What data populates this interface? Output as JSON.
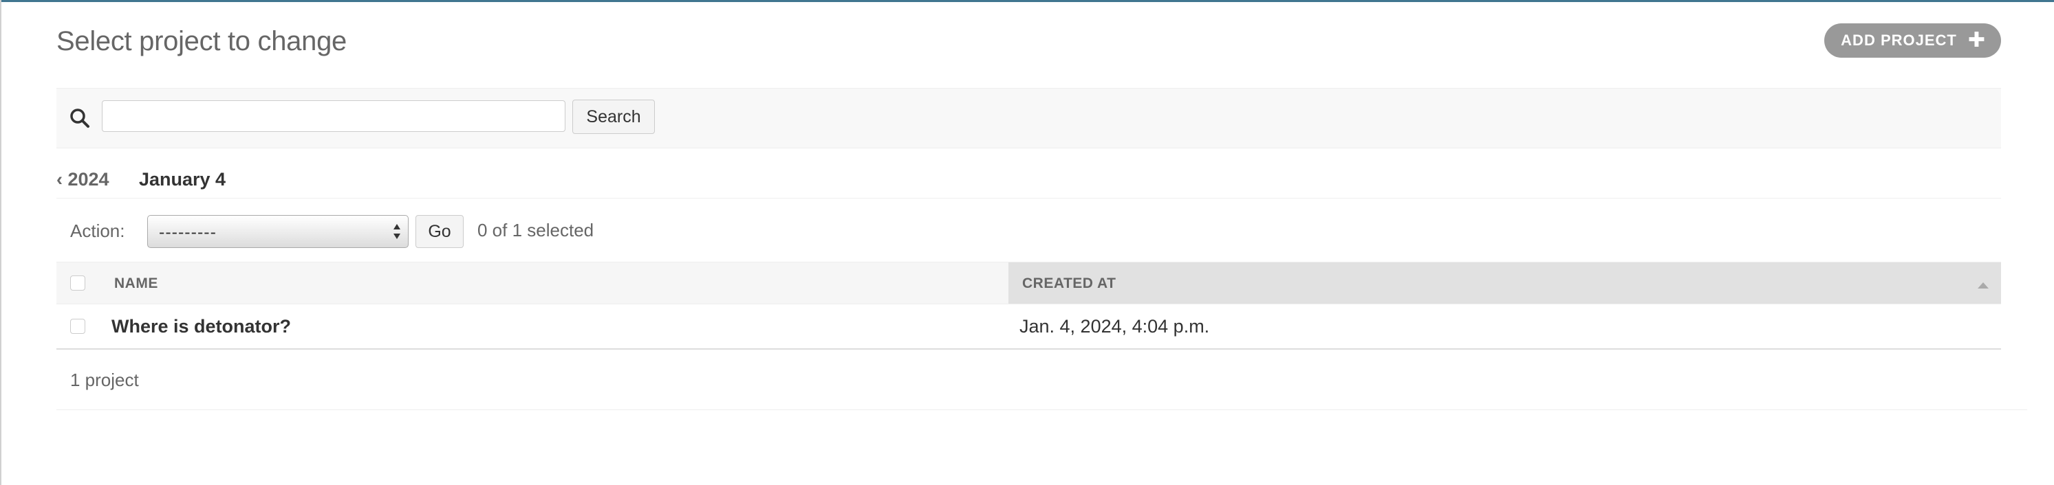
{
  "header": {
    "title": "Select project to change",
    "add_button_label": "ADD PROJECT",
    "add_button_icon": "plus-icon"
  },
  "search": {
    "icon": "search-icon",
    "value": "",
    "button_label": "Search"
  },
  "date_hierarchy": {
    "back_label": "‹ 2024",
    "current_label": "January 4"
  },
  "actions": {
    "label": "Action:",
    "selected_value": "---------",
    "go_label": "Go",
    "selection_status": "0 of 1 selected"
  },
  "table": {
    "columns": [
      {
        "label": "NAME"
      },
      {
        "label": "CREATED AT",
        "sorted": "ascending"
      }
    ],
    "rows": [
      {
        "name": "Where is detonator?",
        "created_at": "Jan. 4, 2024, 4:04 p.m."
      }
    ]
  },
  "paginator": {
    "text": "1 project"
  },
  "colors": {
    "accent": "#417690",
    "add_button": "#999999",
    "sorted_header": "#e1e1e1",
    "toolbar_bg": "#f8f8f8"
  }
}
